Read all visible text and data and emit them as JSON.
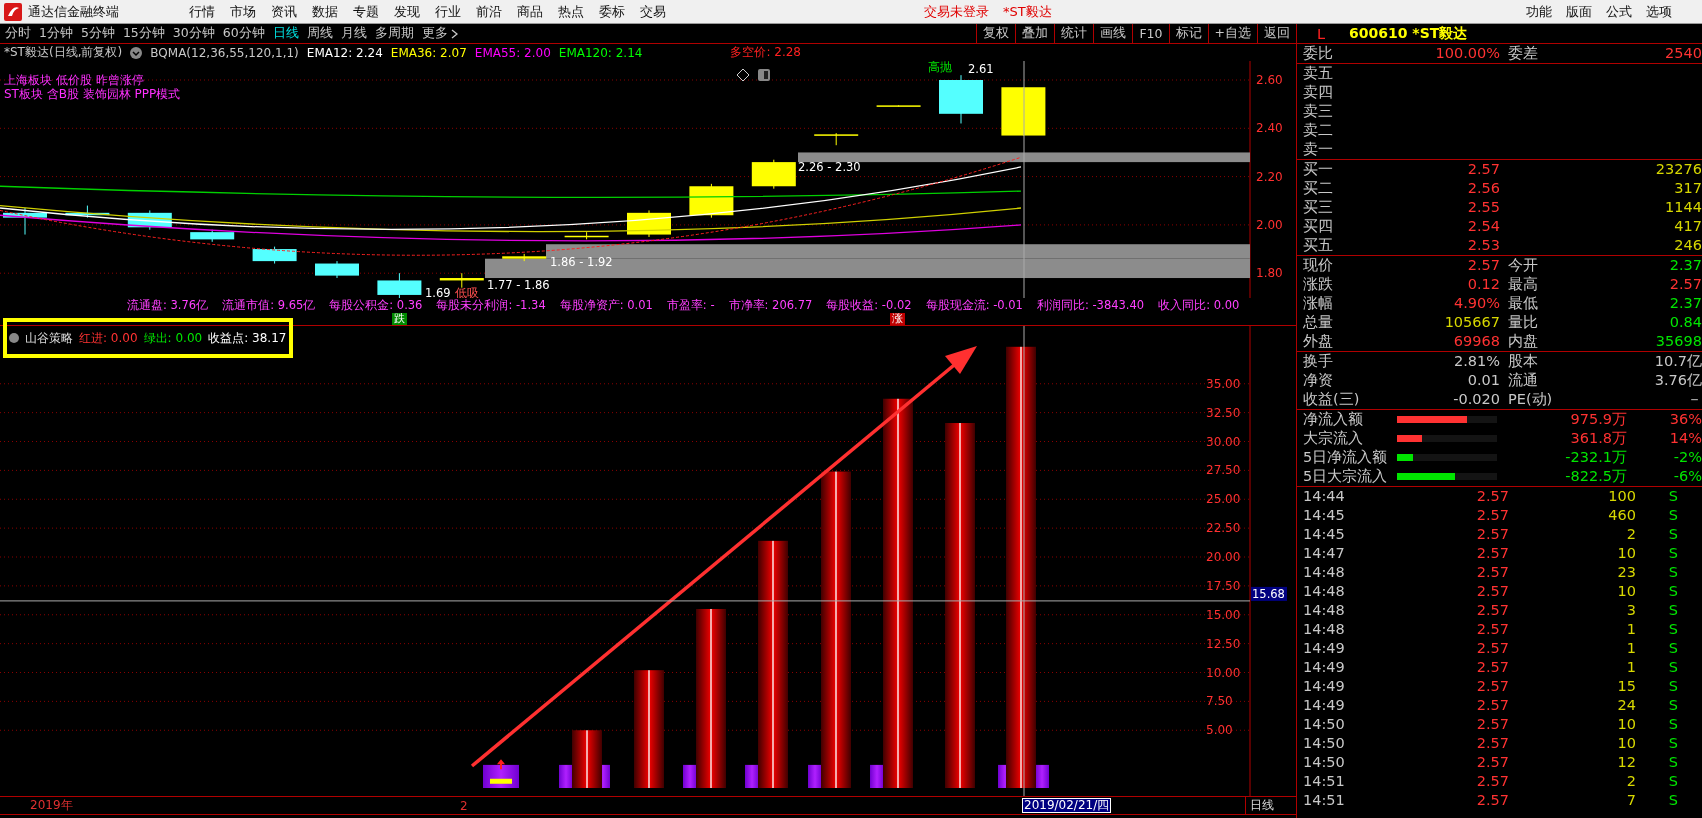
{
  "menu_bar": {
    "app_title": "通达信金融终端",
    "menus": [
      "行情",
      "市场",
      "资讯",
      "数据",
      "专题",
      "发现",
      "行业",
      "前沿",
      "商品",
      "热点",
      "委标",
      "交易"
    ],
    "login_status": "交易未登录",
    "current_stock": "*ST毅达",
    "right_menus": [
      "功能",
      "版面",
      "公式",
      "选项"
    ]
  },
  "toolbar": {
    "periods": [
      {
        "label": "分时",
        "selected": false
      },
      {
        "label": "1分钟",
        "selected": false
      },
      {
        "label": "5分钟",
        "selected": false
      },
      {
        "label": "15分钟",
        "selected": false
      },
      {
        "label": "30分钟",
        "selected": false
      },
      {
        "label": "60分钟",
        "selected": false
      },
      {
        "label": "日线",
        "selected": true
      },
      {
        "label": "周线",
        "selected": false
      },
      {
        "label": "月线",
        "selected": false
      },
      {
        "label": "多周期",
        "selected": false
      },
      {
        "label": "更多",
        "selected": false
      }
    ],
    "actions": [
      "复权",
      "叠加",
      "统计",
      "画线",
      "F10",
      "标记",
      "+自选",
      "返回"
    ]
  },
  "chart_header": {
    "title": "*ST毅达(日线,前复权)",
    "indicator": "BQMA(12,36,55,120,1,1)",
    "values": [
      {
        "text": "EMA12: 2.24",
        "color": "#ffffff"
      },
      {
        "text": "EMA36: 2.07",
        "color": "#ffff00"
      },
      {
        "text": "EMA55: 2.00",
        "color": "#ff00ff"
      },
      {
        "text": "EMA120: 2.14",
        "color": "#00ff00"
      }
    ],
    "long_short_price": "多空价: 2.28",
    "tags": [
      "上海板块 低价股 昨曾涨停",
      "ST板块 含B股 装饰园林 PPP模式"
    ]
  },
  "price_chart": {
    "y_labels": [
      "2.60",
      "2.40",
      "2.20",
      "2.00",
      "1.80"
    ],
    "annotations": [
      {
        "text": "2.26 - 2.30",
        "kind": "zone"
      },
      {
        "text": "1.86 - 1.92",
        "kind": "zone"
      },
      {
        "text": "1.77 - 1.86",
        "kind": "zone"
      },
      {
        "text": "1.69",
        "kind": "price"
      },
      {
        "text": "2.61",
        "kind": "price"
      },
      {
        "text": "高抛",
        "kind": "sell"
      },
      {
        "text": "低吸",
        "kind": "buy"
      }
    ],
    "markers": [
      {
        "text": "跌",
        "kind": "down"
      },
      {
        "text": "涨",
        "kind": "up"
      }
    ]
  },
  "fundamentals": [
    "流通盘: 3.76亿",
    "流通市值: 9.65亿",
    "每股公积金: 0.36",
    "每股未分利润: -1.34",
    "每股净资产: 0.01",
    "市盈率: -",
    "市净率: 206.77",
    "每股收益: -0.02",
    "每股现金流: -0.01",
    "利润同比: -3843.40",
    "收入同比: 0.00"
  ],
  "indicator_panel": {
    "name": "山谷策略",
    "fields": [
      {
        "label": "红进:",
        "value": "0.00",
        "color": "#ff3232"
      },
      {
        "label": "绿出:",
        "value": "0.00",
        "color": "#00e600"
      },
      {
        "label": "收益点:",
        "value": "38.17",
        "color": "#ffffff"
      }
    ],
    "crosshair_value": "15.68",
    "y_labels": [
      "35.00",
      "32.50",
      "30.00",
      "27.50",
      "25.00",
      "22.50",
      "20.00",
      "17.50",
      "15.00",
      "12.50",
      "10.00",
      "7.50",
      "5.00"
    ]
  },
  "time_axis": {
    "year_label": "2019年",
    "month_label": "2",
    "cursor_date": "2019/02/21/四",
    "period": "日线"
  },
  "quote_panel": {
    "market": "L",
    "code_name": "600610 *ST毅达",
    "ratio": {
      "label": "委比",
      "value": "100.00%",
      "label2": "委差",
      "value2": "2540"
    },
    "asks": [
      "卖五",
      "卖四",
      "卖三",
      "卖二",
      "卖一"
    ],
    "bids": [
      {
        "label": "买一",
        "price": "2.57",
        "volume": "23276"
      },
      {
        "label": "买二",
        "price": "2.56",
        "volume": "317"
      },
      {
        "label": "买三",
        "price": "2.55",
        "volume": "1144"
      },
      {
        "label": "买四",
        "price": "2.54",
        "volume": "417"
      },
      {
        "label": "买五",
        "price": "2.53",
        "volume": "246"
      }
    ],
    "stats": [
      {
        "left": {
          "label": "现价",
          "value": "2.57",
          "color": "#ff3232"
        },
        "right": {
          "label": "今开",
          "value": "2.37",
          "color": "#00e600"
        }
      },
      {
        "left": {
          "label": "涨跌",
          "value": "0.12",
          "color": "#ff3232"
        },
        "right": {
          "label": "最高",
          "value": "2.57",
          "color": "#ff3232"
        }
      },
      {
        "left": {
          "label": "涨幅",
          "value": "4.90%",
          "color": "#ff3232"
        },
        "right": {
          "label": "最低",
          "value": "2.37",
          "color": "#00e600"
        }
      },
      {
        "left": {
          "label": "总量",
          "value": "105667",
          "color": "#d8d800"
        },
        "right": {
          "label": "量比",
          "value": "0.84",
          "color": "#00e600"
        }
      },
      {
        "left": {
          "label": "外盘",
          "value": "69968",
          "color": "#ff3232"
        },
        "right": {
          "label": "内盘",
          "value": "35698",
          "color": "#00e600"
        }
      }
    ],
    "finance": [
      {
        "label": "换手",
        "value": "2.81%",
        "label2": "股本",
        "value2": "10.7亿"
      },
      {
        "label": "净资",
        "value": "0.01",
        "label2": "流通",
        "value2": "3.76亿"
      },
      {
        "label": "收益(三)",
        "value": "-0.020",
        "label2": "PE(动)",
        "value2": "－"
      }
    ],
    "flows": [
      {
        "label": "净流入额",
        "level": 0.7,
        "color": "#ff3232",
        "amount": "975.9万",
        "percent": "36%"
      },
      {
        "label": "大宗流入",
        "level": 0.25,
        "color": "#ff3232",
        "amount": "361.8万",
        "percent": "14%"
      },
      {
        "label": "5日净流入额",
        "level": 0.16,
        "color": "#00e600",
        "amount": "-232.1万",
        "percent": "-2%"
      },
      {
        "label": "5日大宗流入",
        "level": 0.58,
        "color": "#00e600",
        "amount": "-822.5万",
        "percent": "-6%"
      }
    ],
    "trades": [
      {
        "time": "14:44",
        "price": "2.57",
        "volume": "100",
        "side": "S"
      },
      {
        "time": "14:45",
        "price": "2.57",
        "volume": "460",
        "side": "S"
      },
      {
        "time": "14:45",
        "price": "2.57",
        "volume": "2",
        "side": "S"
      },
      {
        "time": "14:47",
        "price": "2.57",
        "volume": "10",
        "side": "S"
      },
      {
        "time": "14:48",
        "price": "2.57",
        "volume": "23",
        "side": "S"
      },
      {
        "time": "14:48",
        "price": "2.57",
        "volume": "10",
        "side": "S"
      },
      {
        "time": "14:48",
        "price": "2.57",
        "volume": "3",
        "side": "S"
      },
      {
        "time": "14:48",
        "price": "2.57",
        "volume": "1",
        "side": "S"
      },
      {
        "time": "14:49",
        "price": "2.57",
        "volume": "1",
        "side": "S"
      },
      {
        "time": "14:49",
        "price": "2.57",
        "volume": "1",
        "side": "S"
      },
      {
        "time": "14:49",
        "price": "2.57",
        "volume": "15",
        "side": "S"
      },
      {
        "time": "14:49",
        "price": "2.57",
        "volume": "24",
        "side": "S"
      },
      {
        "time": "14:50",
        "price": "2.57",
        "volume": "10",
        "side": "S"
      },
      {
        "time": "14:50",
        "price": "2.57",
        "volume": "10",
        "side": "S"
      },
      {
        "time": "14:50",
        "price": "2.57",
        "volume": "12",
        "side": "S"
      },
      {
        "time": "14:51",
        "price": "2.57",
        "volume": "2",
        "side": "S"
      },
      {
        "time": "14:51",
        "price": "2.57",
        "volume": "7",
        "side": "S"
      }
    ]
  }
}
